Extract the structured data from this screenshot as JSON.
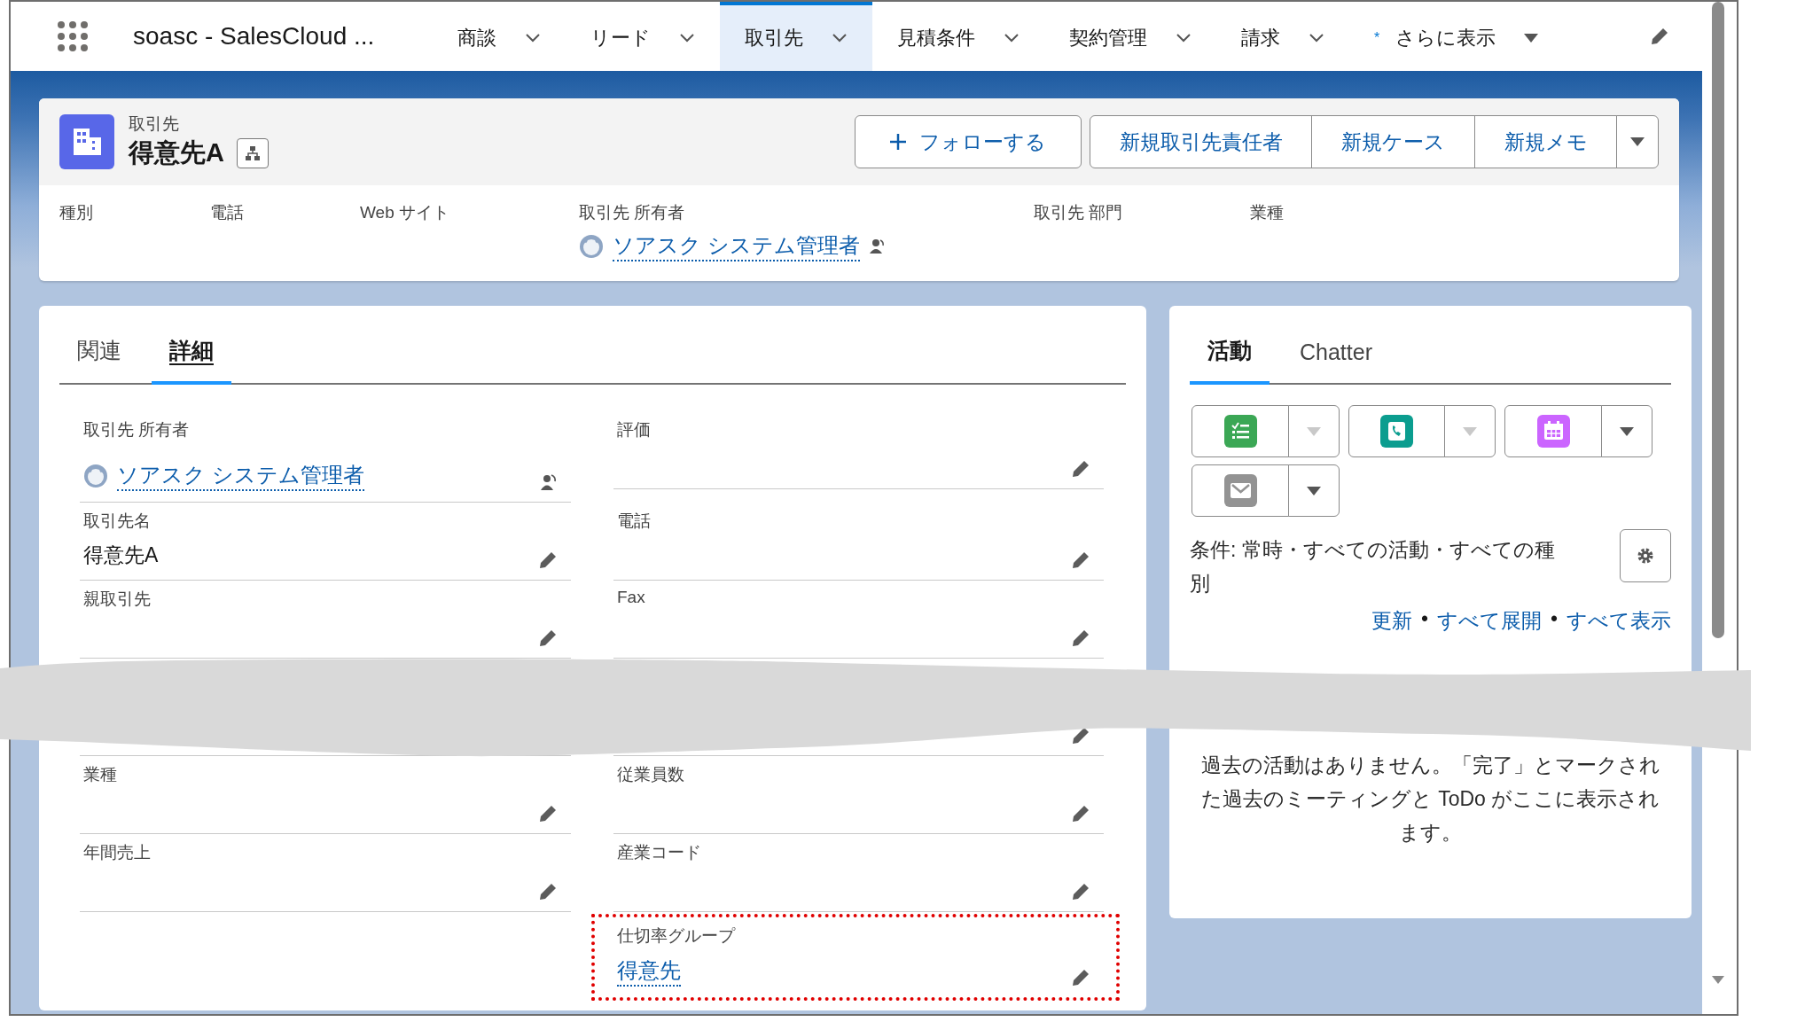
{
  "nav": {
    "title": "soasc - SalesCloud ...",
    "items": [
      {
        "label": "商談",
        "selected": false,
        "kind": "menu"
      },
      {
        "label": "リード",
        "selected": false,
        "kind": "menu"
      },
      {
        "label": "取引先",
        "selected": true,
        "kind": "menu"
      },
      {
        "label": "見積条件",
        "selected": false,
        "kind": "menu"
      },
      {
        "label": "契約管理",
        "selected": false,
        "kind": "menu"
      },
      {
        "label": "請求",
        "selected": false,
        "kind": "menu"
      },
      {
        "label": "さらに表示",
        "selected": false,
        "kind": "more",
        "marker": "*"
      }
    ]
  },
  "header": {
    "object_label": "取引先",
    "record_name": "得意先A",
    "buttons": [
      {
        "kind": "follow",
        "label": "フォローする"
      },
      {
        "kind": "action",
        "label": "新規取引先責任者"
      },
      {
        "kind": "action",
        "label": "新規ケース"
      },
      {
        "kind": "action",
        "label": "新規メモ"
      },
      {
        "kind": "menu"
      }
    ],
    "fields": [
      {
        "label": "種別"
      },
      {
        "label": "電話"
      },
      {
        "label": "Web サイト"
      },
      {
        "label": "取引先 所有者",
        "value": "ソアスク システム管理者",
        "kind": "user"
      },
      {
        "label": "取引先 部門"
      },
      {
        "label": "業種"
      }
    ]
  },
  "details": {
    "tabs": [
      {
        "label": "関連",
        "selected": false
      },
      {
        "label": "詳細",
        "selected": true
      }
    ],
    "columns": [
      [
        {
          "label": "取引先 所有者",
          "value": "ソアスク システム管理者",
          "kind": "user",
          "editable": false,
          "highlighted": false
        },
        {
          "label": "取引先名",
          "value": "得意先A",
          "kind": "text",
          "editable": true,
          "highlighted": false
        },
        {
          "label": "親取引先",
          "kind": "text",
          "editable": true,
          "highlighted": false
        },
        {
          "kind": "hidden"
        },
        {
          "label": "業種",
          "kind": "text",
          "editable": true,
          "highlighted": false
        },
        {
          "label": "年間売上",
          "kind": "text",
          "editable": true,
          "highlighted": false
        }
      ],
      [
        {
          "label": "評価",
          "kind": "text",
          "editable": true,
          "highlighted": false
        },
        {
          "label": "電話",
          "kind": "text",
          "editable": true,
          "highlighted": false
        },
        {
          "label": "Fax",
          "kind": "text",
          "editable": true,
          "highlighted": false
        },
        {
          "kind": "hidden",
          "editable": true
        },
        {
          "label": "従業員数",
          "kind": "text",
          "editable": true,
          "highlighted": false
        },
        {
          "label": "産業コード",
          "kind": "text",
          "editable": true,
          "highlighted": false
        },
        {
          "label": "仕切率グループ",
          "value": "得意先",
          "kind": "link",
          "editable": true,
          "highlighted": true
        }
      ]
    ]
  },
  "activity": {
    "tabs": [
      {
        "label": "活動",
        "selected": true
      },
      {
        "label": "Chatter",
        "selected": false
      }
    ],
    "quick_actions": [
      {
        "kind": "task",
        "color": "#3ba755",
        "menu_disabled": true
      },
      {
        "kind": "call",
        "color": "#0b9d8f",
        "menu_disabled": true
      },
      {
        "kind": "event",
        "color": "#cb65ff",
        "menu_disabled": false
      },
      {
        "kind": "email",
        "color": "#939393",
        "menu_disabled": false
      }
    ],
    "filter_text": "条件: 常時・すべての活動・すべての種別",
    "links": [
      "更新",
      "すべて展開",
      "すべて表示"
    ],
    "link_separator": "•",
    "empty_message": "過去の活動はありません。「完了」とマークされた過去のミーティングと ToDo がここに表示されます。"
  }
}
